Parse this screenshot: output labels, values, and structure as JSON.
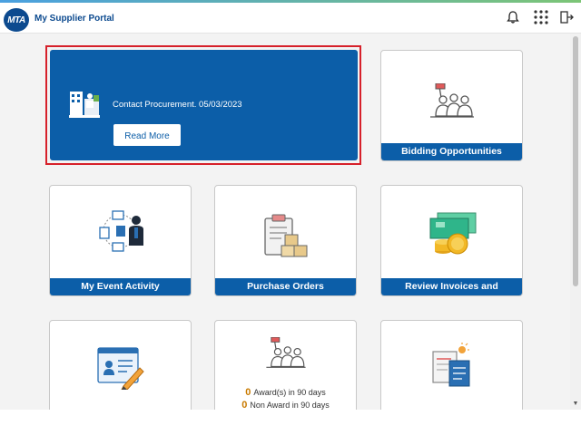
{
  "header": {
    "logo_text": "MTA",
    "title": "My Supplier Portal",
    "icons": [
      "bell-icon",
      "apps-grid-icon",
      "sign-out-icon"
    ]
  },
  "hero": {
    "message": "Contact Procurement. 05/03/2023",
    "button_label": "Read More",
    "icon": "supplier-building-icon"
  },
  "tiles": {
    "bidding": {
      "label": "Bidding Opportunities",
      "icon": "bidding-people-icon"
    },
    "event_activity": {
      "label": "My Event Activity",
      "icon": "event-network-icon"
    },
    "purchase_orders": {
      "label": "Purchase Orders",
      "icon": "clipboard-boxes-icon"
    },
    "invoices": {
      "label": "Review Invoices and Payments",
      "icon": "money-coins-icon"
    },
    "profile": {
      "label": "",
      "icon": "profile-form-icon"
    },
    "awards": {
      "icon": "bidding-people-icon",
      "award_count": "0",
      "award_label": "Award(s) in 90 days",
      "non_award_count": "0",
      "non_award_label": "Non Award in 90 days"
    },
    "documents": {
      "label": "",
      "icon": "documents-icon"
    }
  },
  "colors": {
    "brand_blue": "#0c5ea8",
    "highlight_red": "#d6202a",
    "count_orange": "#c97a00"
  }
}
